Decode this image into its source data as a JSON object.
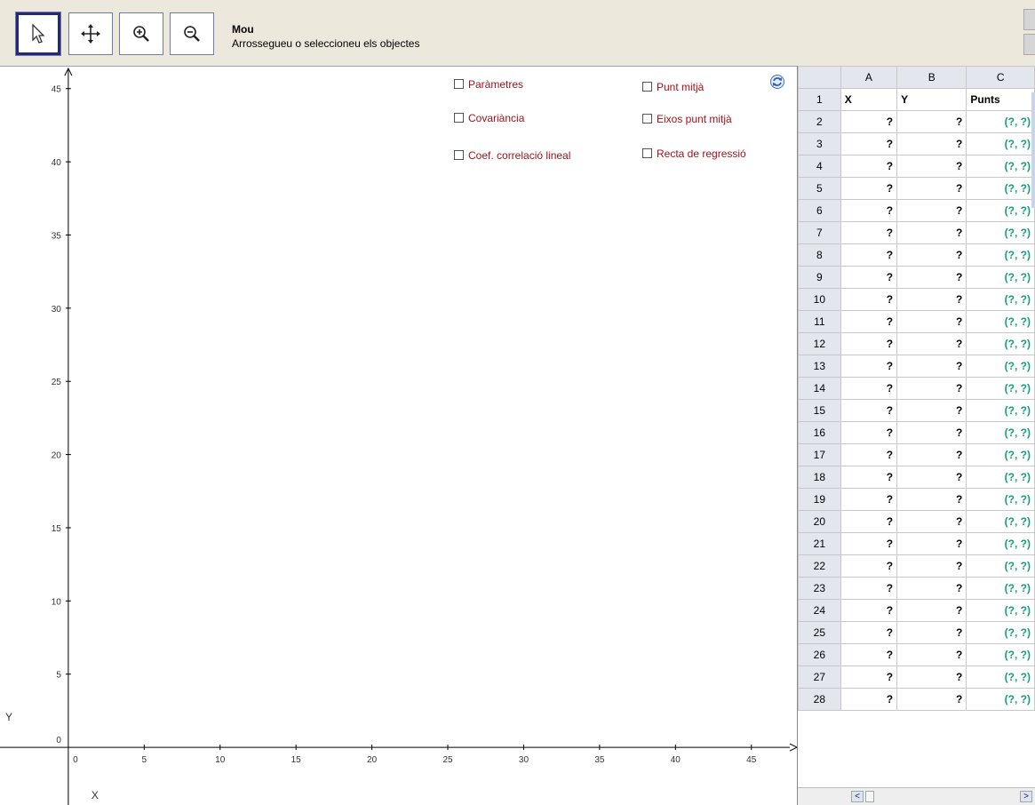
{
  "toolbar": {
    "tools": [
      {
        "name": "move-tool",
        "icon": "arrow-pointer-icon",
        "selected": true
      },
      {
        "name": "move-view-tool",
        "icon": "move-arrows-icon",
        "selected": false
      },
      {
        "name": "zoom-in-tool",
        "icon": "zoom-in-icon",
        "selected": false
      },
      {
        "name": "zoom-out-tool",
        "icon": "zoom-out-icon",
        "selected": false
      }
    ],
    "title": "Mou",
    "help": "Arrossegueu o seleccioneu els objectes"
  },
  "checkboxes": {
    "parametres": "Paràmetres",
    "covariancia": "Covariància",
    "coef": "Coef. correlació lineal",
    "punt_mitja": "Punt mitjà",
    "eixos_punt_mitja": "Eixos punt mitjà",
    "recta": "Recta de regressió"
  },
  "chart_data": {
    "type": "scatter",
    "xlabel": "X",
    "ylabel": "Y",
    "xlim": [
      -4.5,
      48
    ],
    "ylim": [
      -4,
      46.5
    ],
    "x_ticks": [
      "0",
      "5",
      "10",
      "15",
      "20",
      "25",
      "30",
      "35",
      "40",
      "45"
    ],
    "y_ticks": [
      "0",
      "5",
      "10",
      "15",
      "20",
      "25",
      "30",
      "35",
      "40",
      "45"
    ],
    "series": [],
    "grid": false
  },
  "spreadsheet": {
    "columns": [
      "A",
      "B",
      "C"
    ],
    "header_row": {
      "row": "1",
      "a": "X",
      "b": "Y",
      "c": "Punts"
    },
    "rows": [
      {
        "row": "2",
        "a": "?",
        "b": "?",
        "c": "(?, ?)"
      },
      {
        "row": "3",
        "a": "?",
        "b": "?",
        "c": "(?, ?)"
      },
      {
        "row": "4",
        "a": "?",
        "b": "?",
        "c": "(?, ?)"
      },
      {
        "row": "5",
        "a": "?",
        "b": "?",
        "c": "(?, ?)"
      },
      {
        "row": "6",
        "a": "?",
        "b": "?",
        "c": "(?, ?)"
      },
      {
        "row": "7",
        "a": "?",
        "b": "?",
        "c": "(?, ?)"
      },
      {
        "row": "8",
        "a": "?",
        "b": "?",
        "c": "(?, ?)"
      },
      {
        "row": "9",
        "a": "?",
        "b": "?",
        "c": "(?, ?)"
      },
      {
        "row": "10",
        "a": "?",
        "b": "?",
        "c": "(?, ?)"
      },
      {
        "row": "11",
        "a": "?",
        "b": "?",
        "c": "(?, ?)"
      },
      {
        "row": "12",
        "a": "?",
        "b": "?",
        "c": "(?, ?)"
      },
      {
        "row": "13",
        "a": "?",
        "b": "?",
        "c": "(?, ?)"
      },
      {
        "row": "14",
        "a": "?",
        "b": "?",
        "c": "(?, ?)"
      },
      {
        "row": "15",
        "a": "?",
        "b": "?",
        "c": "(?, ?)"
      },
      {
        "row": "16",
        "a": "?",
        "b": "?",
        "c": "(?, ?)"
      },
      {
        "row": "17",
        "a": "?",
        "b": "?",
        "c": "(?, ?)"
      },
      {
        "row": "18",
        "a": "?",
        "b": "?",
        "c": "(?, ?)"
      },
      {
        "row": "19",
        "a": "?",
        "b": "?",
        "c": "(?, ?)"
      },
      {
        "row": "20",
        "a": "?",
        "b": "?",
        "c": "(?, ?)"
      },
      {
        "row": "21",
        "a": "?",
        "b": "?",
        "c": "(?, ?)"
      },
      {
        "row": "22",
        "a": "?",
        "b": "?",
        "c": "(?, ?)"
      },
      {
        "row": "23",
        "a": "?",
        "b": "?",
        "c": "(?, ?)"
      },
      {
        "row": "24",
        "a": "?",
        "b": "?",
        "c": "(?, ?)"
      },
      {
        "row": "25",
        "a": "?",
        "b": "?",
        "c": "(?, ?)"
      },
      {
        "row": "26",
        "a": "?",
        "b": "?",
        "c": "(?, ?)"
      },
      {
        "row": "27",
        "a": "?",
        "b": "?",
        "c": "(?, ?)"
      },
      {
        "row": "28",
        "a": "?",
        "b": "?",
        "c": "(?, ?)"
      }
    ]
  },
  "colors": {
    "checkbox_label": "#a1121a",
    "point_text": "#11a07a",
    "selected_tool_border": "#22287a"
  }
}
